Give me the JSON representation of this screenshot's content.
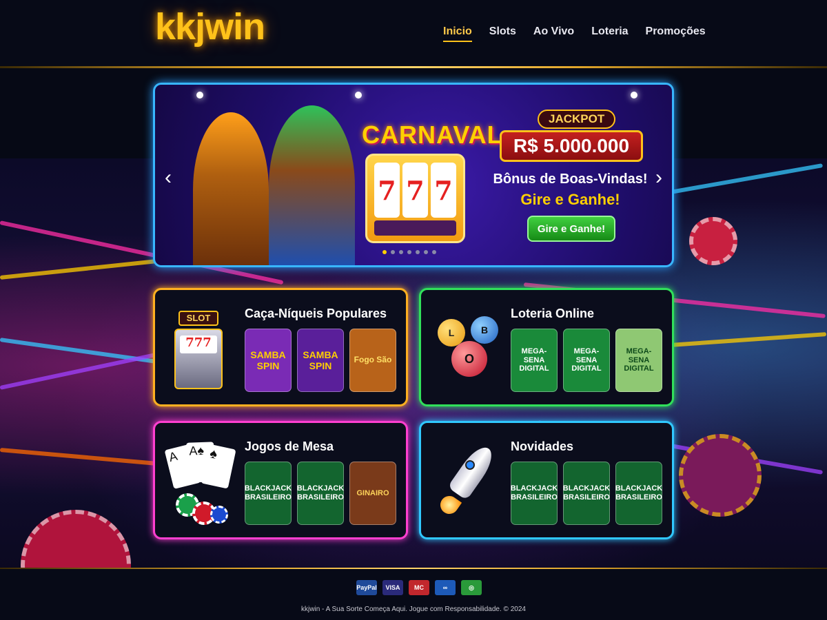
{
  "brand": {
    "name": "kkjwin"
  },
  "nav": {
    "items": [
      {
        "label": "Inicio",
        "active": true
      },
      {
        "label": "Slots",
        "active": false
      },
      {
        "label": "Ao Vivo",
        "active": false
      },
      {
        "label": "Loteria",
        "active": false
      },
      {
        "label": "Promoções",
        "active": false
      }
    ]
  },
  "banner": {
    "headline": "CARNAVAL",
    "reels": [
      "7",
      "7",
      "7"
    ],
    "jackpot_label": "JACKPOT",
    "jackpot_amount": "R$ 5.000.000",
    "bonus_line1": "Bônus de Boas-Vindas!",
    "bonus_line2": "Gire e Ganhe!",
    "cta_label": "Gire e Ganhe!",
    "prev_icon": "chevron-left-icon",
    "next_icon": "chevron-right-icon",
    "slide_count": 7,
    "active_slide": 1
  },
  "categories": [
    {
      "title": "Caça-Níqueis Populares",
      "border": "#ffb020",
      "icon_label": "SLOT",
      "tiles": [
        {
          "label": "SAMBA SPIN",
          "bg": "#7a2bb5"
        },
        {
          "label": "SAMBA SPIN",
          "bg": "#5a1f9a"
        },
        {
          "label": "Fogo São",
          "bg": "#b8631a"
        }
      ]
    },
    {
      "title": "Loteria Online",
      "border": "#30e05a",
      "balls": [
        "L",
        "B",
        "O"
      ],
      "tiles": [
        {
          "label": "MEGA-SENA DIGITAL",
          "bg": "#1a8a3a"
        },
        {
          "label": "MEGA-SENA DIGITAL",
          "bg": "#1a8a3a"
        },
        {
          "label": "MEGA-SENA DIGITAL",
          "bg": "#8fc873"
        }
      ]
    },
    {
      "title": "Jogos de Mesa",
      "border": "#ff3fd0",
      "tiles": [
        {
          "label": "BLACKJACK BRASILEIRO",
          "bg": "#13652f"
        },
        {
          "label": "BLACKJACK BRASILEIRO",
          "bg": "#13652f"
        },
        {
          "label": "GINAIRO",
          "bg": "#7a3a1a"
        }
      ]
    },
    {
      "title": "Novidades",
      "border": "#30c8ff",
      "tiles": [
        {
          "label": "BLACKJACK BRASILEIRO",
          "bg": "#13652f"
        },
        {
          "label": "BLACKJACK BRASILEIRO",
          "bg": "#13652f"
        },
        {
          "label": "BLACKJACK BRASILEIRO",
          "bg": "#13652f"
        }
      ]
    }
  ],
  "footer": {
    "payments": [
      {
        "label": "PayPal",
        "bg": "#1f4a9a"
      },
      {
        "label": "VISA",
        "bg": "#2a2a7a"
      },
      {
        "label": "MC",
        "bg": "#c1272d"
      },
      {
        "label": "∞",
        "bg": "#1d5ab8"
      },
      {
        "label": "◎",
        "bg": "#2a9a3a"
      }
    ],
    "text": "kkjwin - A Sua Sorte Começa Aqui. Jogue com Responsabilidade. © 2024"
  }
}
